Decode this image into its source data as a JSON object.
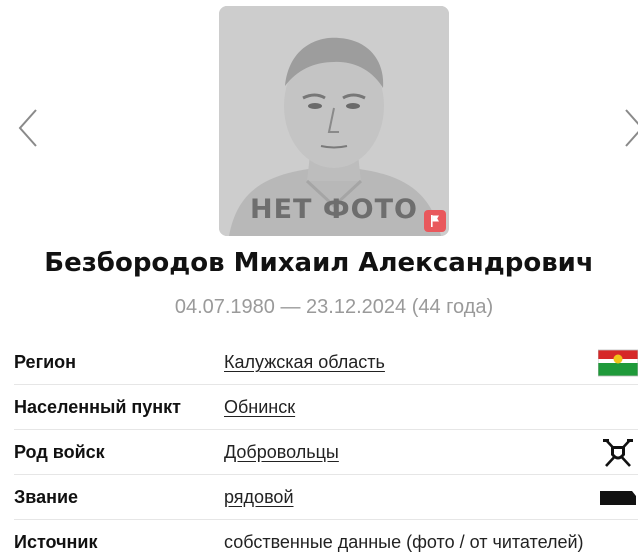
{
  "person": {
    "name": "Безбородов Михаил Александрович",
    "dates": "04.07.1980 — 23.12.2024 (44 года)"
  },
  "photo": {
    "placeholder_text": "НЕТ ФОТО"
  },
  "icons": {
    "prev": "chevron-left-icon",
    "next": "chevron-right-icon",
    "report": "report-flag-icon",
    "region": "region-flag-icon",
    "troops": "troops-emblem-icon",
    "rank": "rank-insignia-icon"
  },
  "colors": {
    "accent_red": "#e9585c",
    "muted_text": "#9a9a9a",
    "region_flag_red": "#d62828",
    "region_flag_green": "#1f9a3a"
  },
  "info": {
    "rows": [
      {
        "label": "Регион",
        "value": "Калужская область"
      },
      {
        "label": "Населенный пункт",
        "value": "Обнинск"
      },
      {
        "label": "Род войск",
        "value": "Добровольцы"
      },
      {
        "label": "Звание",
        "value": "рядовой"
      },
      {
        "label": "Источник",
        "value": "собственные данные (фото / от читателей)"
      }
    ]
  }
}
